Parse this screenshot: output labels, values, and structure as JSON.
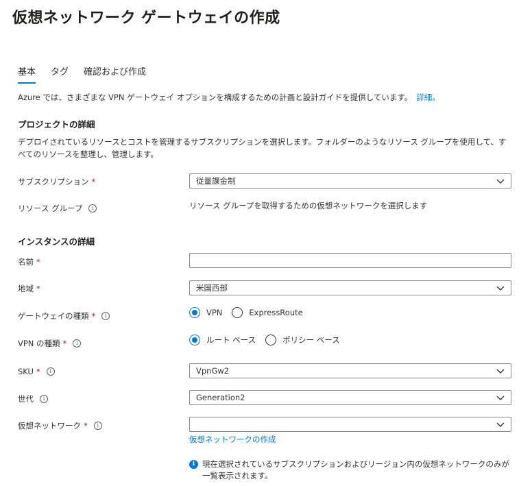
{
  "header": {
    "title": "仮想ネットワーク ゲートウェイの作成",
    "more": "···"
  },
  "tabs": [
    {
      "label": "基本",
      "active": true
    },
    {
      "label": "タグ",
      "active": false
    },
    {
      "label": "確認および作成",
      "active": false
    }
  ],
  "intro": {
    "text": "Azure では、さまざまな VPN ゲートウェイ オプションを構成するための計画と設計ガイドを提供しています。",
    "link": "詳細。"
  },
  "project": {
    "heading": "プロジェクトの詳細",
    "description": "デプロイされているリソースとコストを管理するサブスクリプションを選択します。フォルダーのようなリソース グループを使用して、すべてのリソースを整理し、管理します。",
    "subscription_label": "サブスクリプション",
    "subscription_value": "従量課金制",
    "resource_group_label": "リソース グループ",
    "resource_group_text": "リソース グループを取得するための仮想ネットワークを選択します"
  },
  "instance": {
    "heading": "インスタンスの詳細",
    "name_label": "名前",
    "name_value": "",
    "region_label": "地域",
    "region_value": "米国西部",
    "gateway_type_label": "ゲートウェイの種類",
    "gateway_type_options": [
      "VPN",
      "ExpressRoute"
    ],
    "gateway_type_selected": "VPN",
    "vpn_type_label": "VPN の種類",
    "vpn_type_options": [
      "ルート ベース",
      "ポリシー ベース"
    ],
    "vpn_type_selected": "ルート ベース",
    "sku_label": "SKU",
    "sku_value": "VpnGw2",
    "generation_label": "世代",
    "generation_value": "Generation2",
    "vnet_label": "仮想ネットワーク",
    "vnet_value": "",
    "vnet_create_link": "仮想ネットワークの作成",
    "vnet_note": "現在選択されているサブスクリプションおよびリージョン内の仮想ネットワークのみが一覧表示されます。"
  },
  "required_mark": "*",
  "info_glyph": "i",
  "colors": {
    "accent": "#0078d4",
    "required": "#a4262c",
    "text": "#323130"
  }
}
